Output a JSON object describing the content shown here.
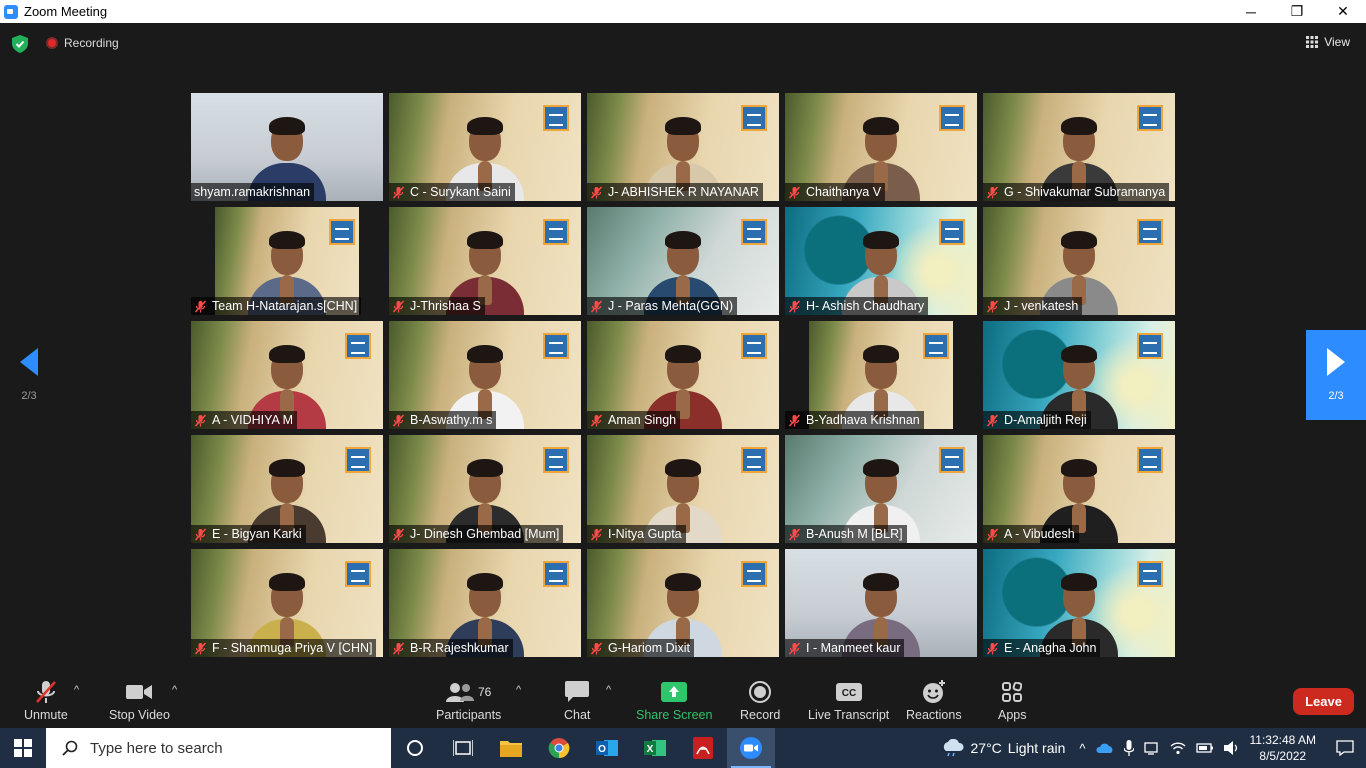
{
  "window": {
    "title": "Zoom Meeting",
    "minimize_glyph": "─",
    "maximize_glyph": "❐",
    "close_glyph": "✕"
  },
  "meeting": {
    "recording_label": "Recording",
    "view_label": "View"
  },
  "participants_grid": [
    {
      "name": "shyam.ramakrishnan",
      "muted": false,
      "bg": "room"
    },
    {
      "name": "C - Surykant Saini",
      "muted": true,
      "bg": "plant"
    },
    {
      "name": "J- ABHISHEK R NAYANAR",
      "muted": true,
      "bg": "plant"
    },
    {
      "name": "Chaithanya V",
      "muted": true,
      "bg": "plant"
    },
    {
      "name": "G - Shivakumar Subramanya",
      "muted": true,
      "bg": "plant"
    },
    {
      "name": "Team H-Natarajan.s[CHN]",
      "muted": true,
      "bg": "plant-inset"
    },
    {
      "name": "J-Thrishaa S",
      "muted": true,
      "bg": "plant"
    },
    {
      "name": "J - Paras Mehta(GGN)",
      "muted": true,
      "bg": "office"
    },
    {
      "name": "H- Ashish Chaudhary",
      "muted": true,
      "bg": "teal"
    },
    {
      "name": "J - venkatesh",
      "muted": true,
      "bg": "plant"
    },
    {
      "name": "A - VIDHIYA M",
      "muted": true,
      "bg": "plant"
    },
    {
      "name": "B-Aswathy.m s",
      "muted": true,
      "bg": "plant"
    },
    {
      "name": "Aman Singh",
      "muted": true,
      "bg": "plant"
    },
    {
      "name": "B-Yadhava Krishnan",
      "muted": true,
      "bg": "plant-inset"
    },
    {
      "name": "D-Amaljith Reji",
      "muted": true,
      "bg": "teal"
    },
    {
      "name": "E - Bigyan Karki",
      "muted": true,
      "bg": "plant"
    },
    {
      "name": "J- Dinesh Ghembad [Mum]",
      "muted": true,
      "bg": "plant"
    },
    {
      "name": "I-Nitya Gupta",
      "muted": true,
      "bg": "plant"
    },
    {
      "name": "B-Anush M [BLR]",
      "muted": true,
      "bg": "office"
    },
    {
      "name": "A - Vibudesh",
      "muted": true,
      "bg": "plant"
    },
    {
      "name": "F - Shanmuga Priya V [CHN]",
      "muted": true,
      "bg": "plant"
    },
    {
      "name": "B-R.Rajeshkumar",
      "muted": true,
      "bg": "plant"
    },
    {
      "name": "G-Hariom Dixit",
      "muted": true,
      "bg": "plant"
    },
    {
      "name": "I - Manmeet kaur",
      "muted": true,
      "bg": "room"
    },
    {
      "name": "E - Anagha John",
      "muted": true,
      "bg": "teal"
    }
  ],
  "pager": {
    "left_page": "2/3",
    "right_page": "2/3"
  },
  "toolbar": {
    "unmute": "Unmute",
    "stop_video": "Stop Video",
    "participants": "Participants",
    "participants_count": "76",
    "chat": "Chat",
    "share_screen": "Share Screen",
    "record": "Record",
    "live_transcript": "Live Transcript",
    "reactions": "Reactions",
    "apps": "Apps",
    "leave": "Leave",
    "share_color": "#2ec56b",
    "leave_color": "#cc2a1f"
  },
  "taskbar": {
    "search_placeholder": "Type here to search",
    "apps": [
      "cortana-icon",
      "task-view-icon",
      "file-explorer-icon",
      "chrome-icon",
      "outlook-icon",
      "excel-icon",
      "acrobat-icon",
      "zoom-icon"
    ],
    "weather_temp": "27°C",
    "weather_condition": "Light rain",
    "time": "11:32:48 AM",
    "date": "8/5/2022"
  }
}
